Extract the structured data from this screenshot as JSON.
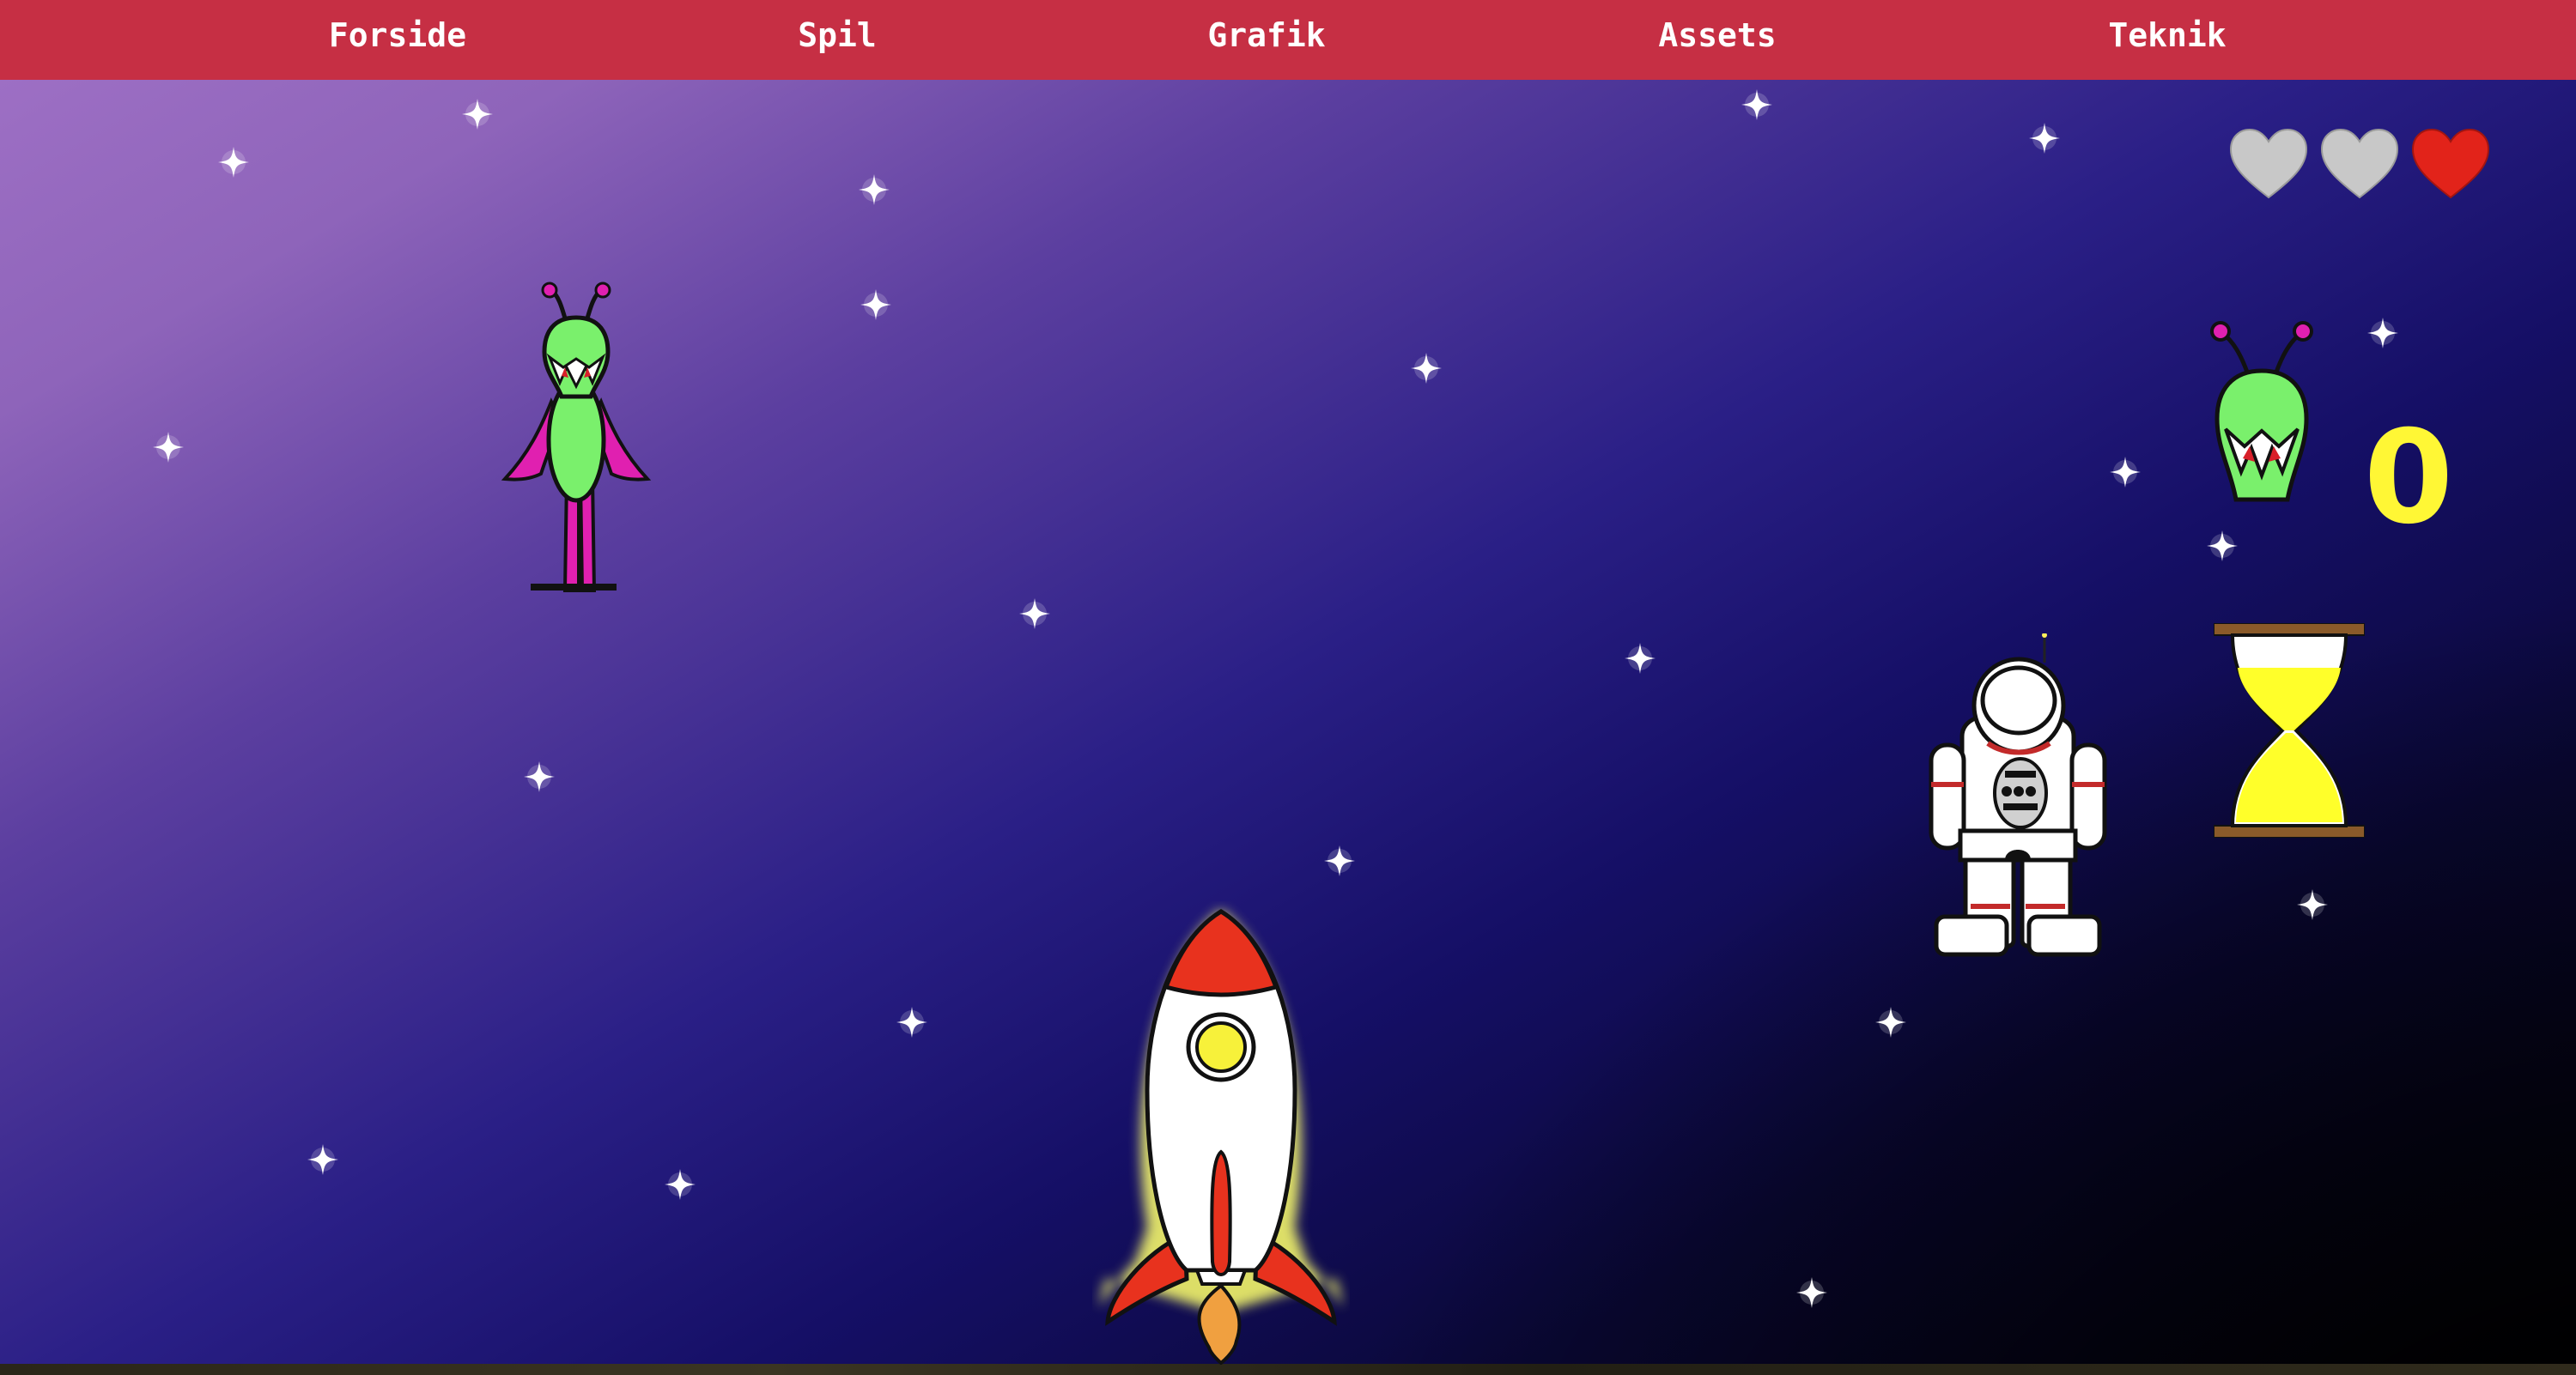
{
  "nav": {
    "items": [
      {
        "label": "Forside"
      },
      {
        "label": "Spil"
      },
      {
        "label": "Grafik"
      },
      {
        "label": "Assets"
      },
      {
        "label": "Teknik"
      }
    ]
  },
  "hud": {
    "lives_total": 3,
    "lives_remaining": 1,
    "score": "0",
    "timer_icon": "hourglass-icon",
    "score_icon": "alien-head-icon"
  },
  "colors": {
    "nav_bg": "#c62f44",
    "heart_full": "#e2231a",
    "heart_empty": "#c8c8c8",
    "score_text": "#fff735",
    "alien_green": "#7af06c",
    "alien_magenta": "#e020b0",
    "rocket_red": "#e8321e"
  },
  "sprites": {
    "enemy": "alien",
    "player": "rocket",
    "pickup": "astronaut"
  }
}
